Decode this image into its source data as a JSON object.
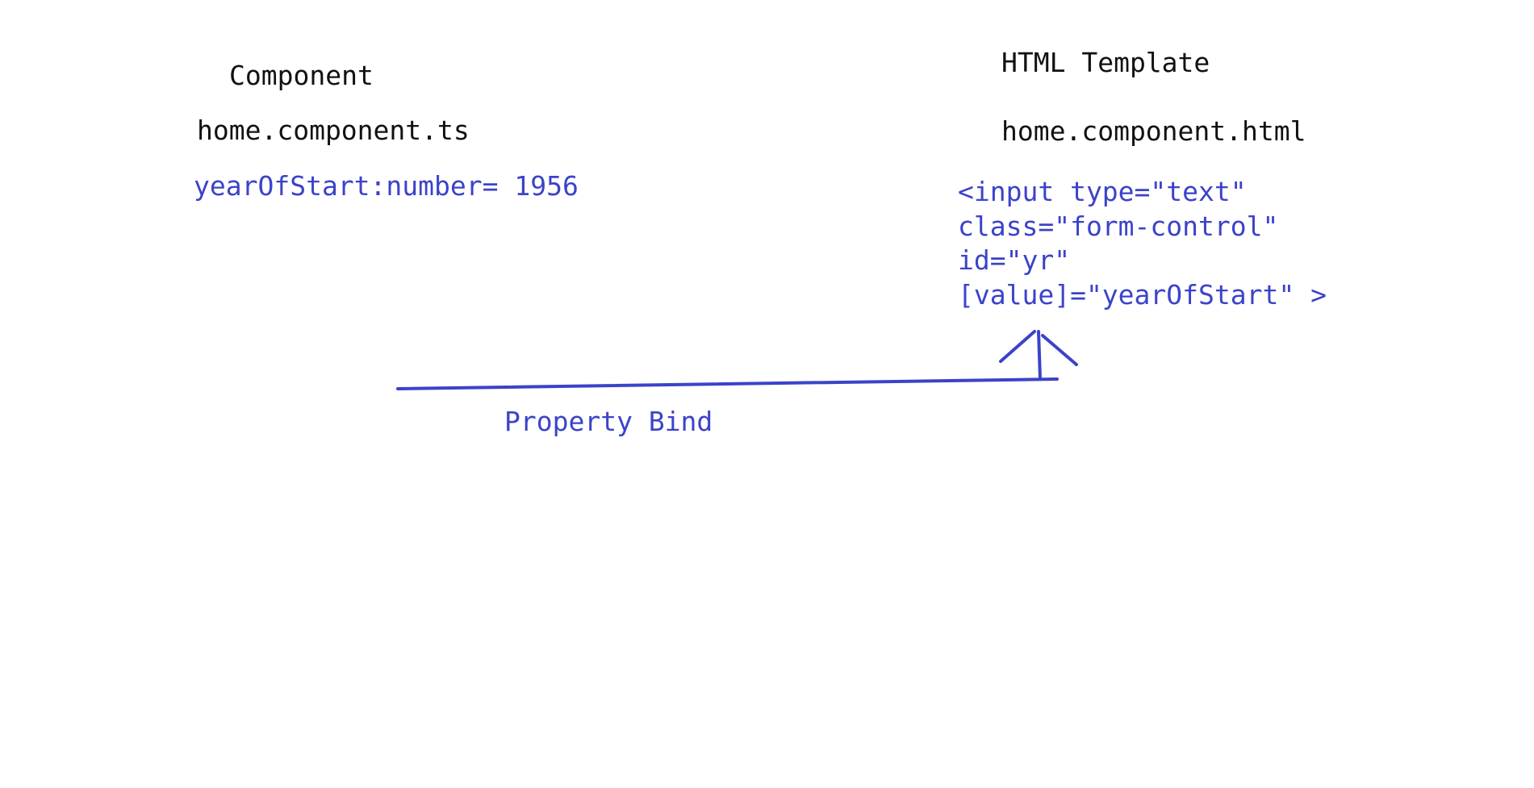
{
  "component": {
    "heading": "Component",
    "filename": "home.component.ts",
    "code": "yearOfStart:number= 1956"
  },
  "template": {
    "heading": "HTML Template",
    "filename": "home.component.html",
    "code_lines": [
      "<input type=\"text\"",
      "class=\"form-control\"",
      "id=\"yr\"",
      "[value]=\"yearOfStart\" >"
    ]
  },
  "binding": {
    "label": "Property Bind"
  },
  "colors": {
    "heading_text": "#111111",
    "code_text": "#3b43c9",
    "connector": "#3b43c9",
    "background": "#ffffff"
  }
}
